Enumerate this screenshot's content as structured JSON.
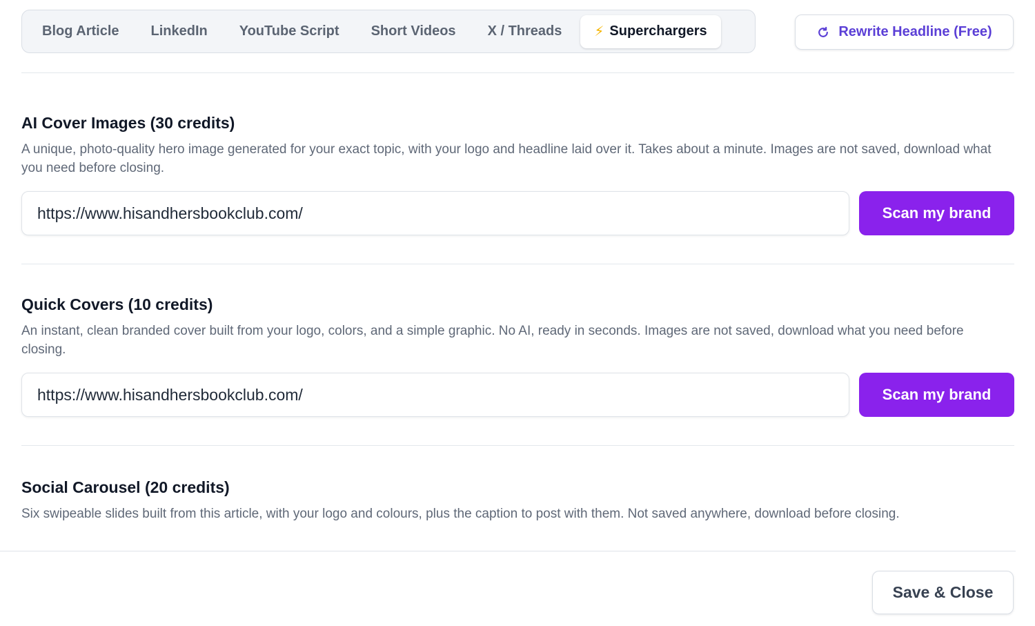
{
  "tabs": [
    {
      "label": "Blog Article",
      "active": false
    },
    {
      "label": "LinkedIn",
      "active": false
    },
    {
      "label": "YouTube Script",
      "active": false
    },
    {
      "label": "Short Videos",
      "active": false
    },
    {
      "label": "X / Threads",
      "active": false
    },
    {
      "label": "Superchargers",
      "active": true,
      "icon": "lightning-bolt-icon"
    }
  ],
  "header": {
    "rewrite_label": "Rewrite Headline (Free)",
    "rewrite_icon": "refresh-icon"
  },
  "sections": [
    {
      "title": "AI Cover Images (30 credits)",
      "description": "A unique, photo-quality hero image generated for your exact topic, with your logo and headline laid over it. Takes about a minute. Images are not saved, download what you need before closing.",
      "url_value": "https://www.hisandhersbookclub.com/",
      "button_label": "Scan my brand"
    },
    {
      "title": "Quick Covers (10 credits)",
      "description": "An instant, clean branded cover built from your logo, colors, and a simple graphic. No AI, ready in seconds. Images are not saved, download what you need before closing.",
      "url_value": "https://www.hisandhersbookclub.com/",
      "button_label": "Scan my brand"
    },
    {
      "title": "Social Carousel (20 credits)",
      "description": "Six swipeable slides built from this article, with your logo and colours, plus the caption to post with them. Not saved anywhere, download before closing."
    }
  ],
  "footer": {
    "save_label": "Save & Close"
  },
  "colors": {
    "accent_purple": "#8a22ec",
    "link_purple": "#5b3fd6",
    "bolt_yellow": "#f5b400"
  }
}
